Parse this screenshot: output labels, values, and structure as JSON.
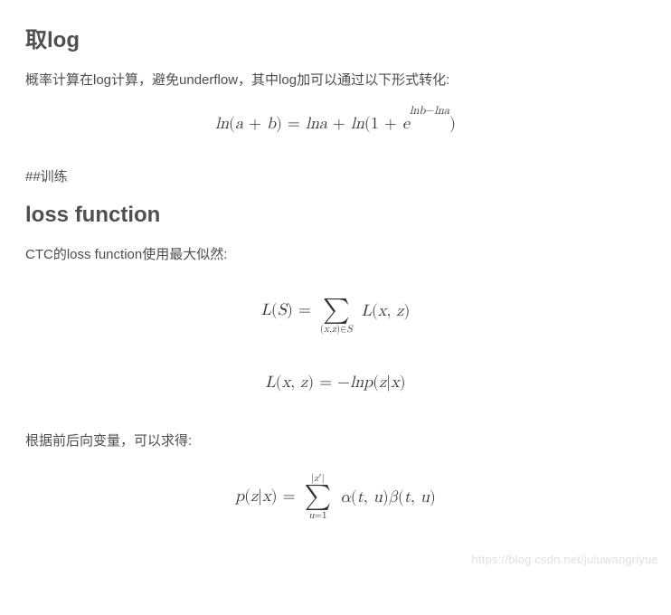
{
  "sections": [
    {
      "heading": "取log",
      "paragraphs": [
        "概率计算在log计算，避免underflow，其中log加可以通过以下形式转化:"
      ],
      "equations": [
        {
          "display": "ln(a + b) = lna + ln(1 + e^{lnb−lna})",
          "latex": "\\ln(a+b) = \\ln a + \\ln(1 + e^{\\ln b - \\ln a})"
        }
      ]
    }
  ],
  "raw_heading": "##训练",
  "sections2": [
    {
      "heading": "loss function",
      "paragraphs": [
        "CTC的loss function使用最大似然:"
      ],
      "equations": [
        {
          "display": "L(S) = Σ_{(x,z)∈S} L(x, z)",
          "latex": "L(S) = \\sum_{(x,z)\\in S} L(x,z)"
        },
        {
          "display": "L(x, z) = −ln p(z|x)",
          "latex": "L(x,z) = -\\ln p(z\\mid x)"
        }
      ],
      "paragraphs2": [
        "根据前后向变量，可以求得:"
      ],
      "equations2": [
        {
          "display": "p(z|x) = Σ_{u=1}^{|z'|} α(t, u) β(t, u)",
          "latex": "p(z\\mid x) = \\sum_{u=1}^{|z'|} \\alpha(t,u)\\beta(t,u)"
        }
      ]
    }
  ],
  "watermark": "https://blog.csdn.net/juluwangriyue"
}
